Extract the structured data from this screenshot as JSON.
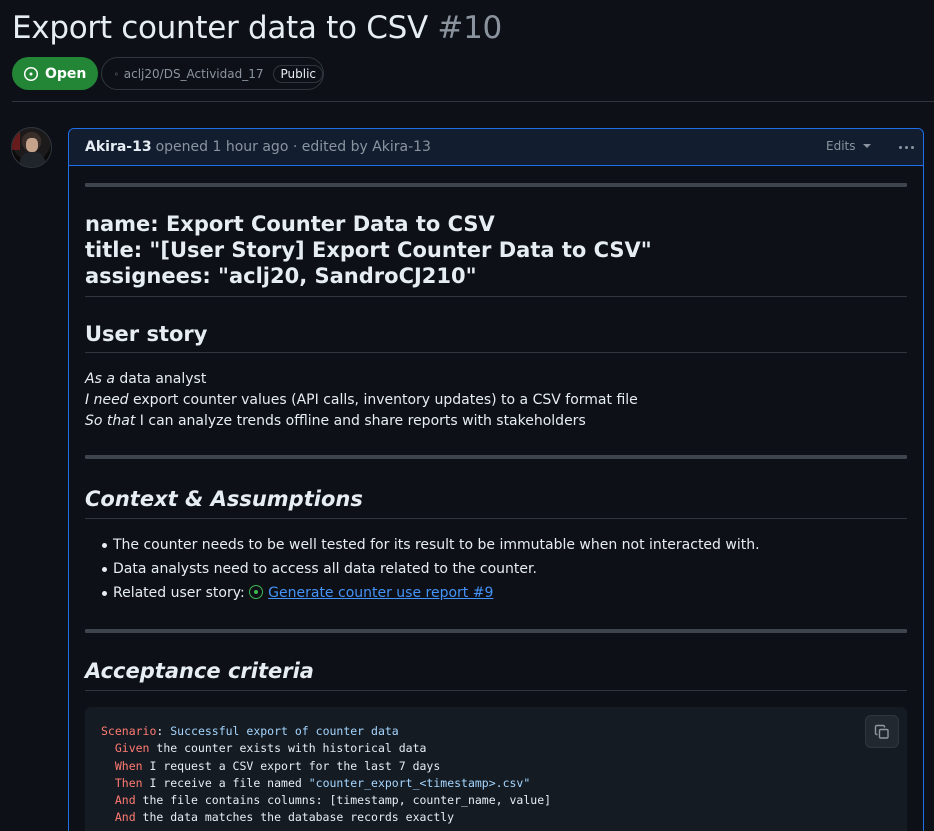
{
  "issue": {
    "title": "Export counter data to CSV",
    "number": "#10",
    "state": "Open",
    "repo": "aclj20/DS_Actividad_17",
    "visibility": "Public"
  },
  "comment": {
    "author": "Akira-13",
    "meta": "opened 1 hour ago · edited by Akira-13",
    "edits_label": "Edits"
  },
  "body": {
    "front_matter": [
      "name: Export Counter Data to CSV",
      "title: \"[User Story] Export Counter Data to CSV\"",
      "assignees: \"aclj20, SandroCJ210\""
    ],
    "user_story": {
      "heading": "User story",
      "lines": [
        {
          "em": "As a",
          "text": " data analyst"
        },
        {
          "em": "I need",
          "text": " export counter values (API calls, inventory updates) to a CSV format file"
        },
        {
          "em": "So that",
          "text": " I can analyze trends offline and share reports with stakeholders"
        }
      ]
    },
    "context": {
      "heading": "Context & Assumptions",
      "items": [
        "The counter needs to be well tested for its result to be immutable when not interacted with.",
        "Data analysts need to access all data related to the counter."
      ],
      "related_label": "Related user story: ",
      "related_link": "Generate counter use report #9"
    },
    "acceptance": {
      "heading": "Acceptance criteria",
      "code": [
        {
          "kw": "Scenario",
          "sep": ": ",
          "rest_str": "Successful export of counter data"
        },
        {
          "kw": "  Given",
          "rest": " the counter exists with historical data"
        },
        {
          "kw": "  When",
          "rest": " I request a CSV export for the last 7 days"
        },
        {
          "kw": "  Then",
          "rest": " I receive a file named ",
          "str": "\"counter_export_<timestamp>.csv\""
        },
        {
          "kw": "  And",
          "rest": " the file contains columns: [timestamp, counter_name, value]"
        },
        {
          "kw": "  And",
          "rest": " the data matches the database records exactly"
        }
      ]
    }
  },
  "colors": {
    "open_green": "#238636",
    "link_blue": "#4493f8",
    "keyword_red": "#ff7b72",
    "string_blue": "#a5d6ff",
    "highlight_border": "#1f6feb"
  }
}
